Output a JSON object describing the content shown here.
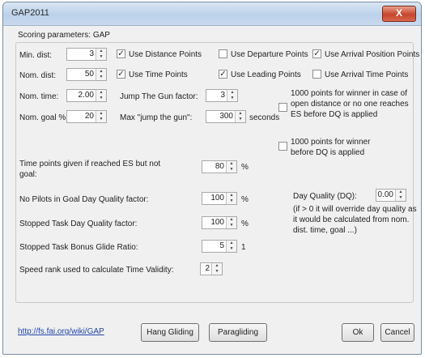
{
  "window": {
    "title": "GAP2011",
    "close_glyph": "X"
  },
  "group_label": "Scoring parameters: GAP",
  "fields": {
    "min_dist": {
      "label": "Min. dist:",
      "value": "3"
    },
    "nom_dist": {
      "label": "Nom. dist:",
      "value": "50"
    },
    "nom_time": {
      "label": "Nom. time:",
      "value": "2.00"
    },
    "nom_goal": {
      "label": "Nom. goal %:",
      "value": "20"
    },
    "jtg_factor": {
      "label": "Jump The Gun factor:",
      "value": "3"
    },
    "max_jtg": {
      "label": "Max \"jump the gun\":",
      "value": "300",
      "unit": "seconds"
    }
  },
  "checkboxes": {
    "use_distance": {
      "label": "Use Distance Points",
      "checked": true
    },
    "use_departure": {
      "label": "Use Departure Points",
      "checked": false
    },
    "use_arrival_pos": {
      "label": "Use Arrival Position Points",
      "checked": true
    },
    "use_time": {
      "label": "Use Time Points",
      "checked": true
    },
    "use_leading": {
      "label": "Use Leading Points",
      "checked": true
    },
    "use_arrival_time": {
      "label": "Use Arrival Time Points",
      "checked": false
    },
    "winner_1000_open": {
      "label_lines": [
        "1000 points for winner in case of",
        "open distance or no one reaches",
        "ES before DQ is applied"
      ],
      "checked": false
    },
    "winner_1000_before": {
      "label_lines": [
        "1000 points for winner",
        "before DQ is applied"
      ],
      "checked": false
    }
  },
  "lower": {
    "time_points_es": {
      "label_lines": [
        "Time points given if reached ES but not",
        "goal:"
      ],
      "value": "80",
      "unit": "%"
    },
    "no_pilots_goal": {
      "label": "No Pilots in Goal Day Quality factor:",
      "value": "100",
      "unit": "%"
    },
    "stopped_task": {
      "label": "Stopped Task Day Quality factor:",
      "value": "100",
      "unit": "%"
    },
    "bonus_glide": {
      "label": "Stopped Task Bonus Glide Ratio:",
      "value": "5",
      "unit": "1"
    },
    "speed_rank": {
      "label": "Speed rank used to calculate Time Validity:",
      "value": "2"
    }
  },
  "day_quality": {
    "label": "Day Quality (DQ):",
    "value": "0.00",
    "note_lines": [
      "(if > 0 it will override day quality as",
      "it would be calculated from nom.",
      "dist. time, goal ...)"
    ]
  },
  "footer": {
    "link": "http://fs.fai.org/wiki/GAP",
    "hang_gliding": "Hang Gliding",
    "paragliding": "Paragliding",
    "ok": "Ok",
    "cancel": "Cancel"
  }
}
